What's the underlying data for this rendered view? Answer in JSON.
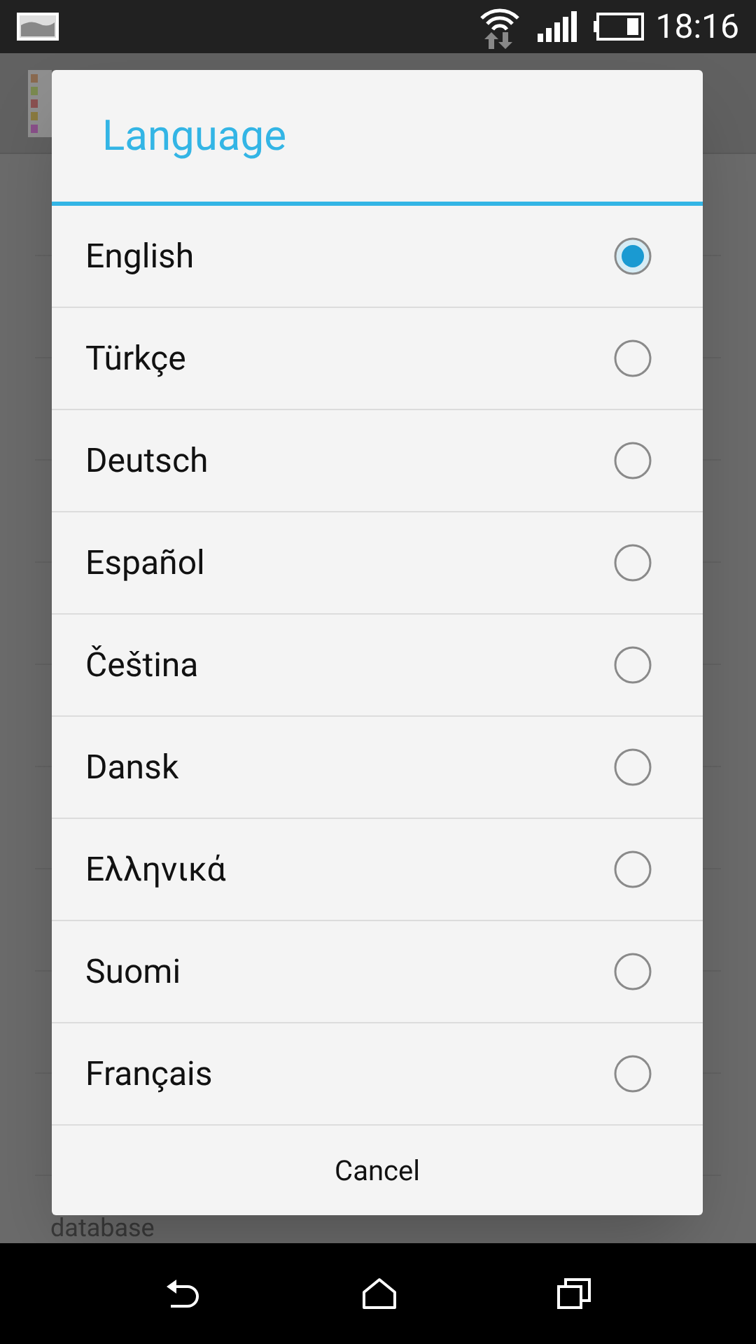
{
  "status_bar": {
    "time": "18:16"
  },
  "background": {
    "text": "database"
  },
  "dialog": {
    "title": "Language",
    "options": [
      {
        "label": "English",
        "selected": true
      },
      {
        "label": "Türkçe",
        "selected": false
      },
      {
        "label": "Deutsch",
        "selected": false
      },
      {
        "label": "Español",
        "selected": false
      },
      {
        "label": "Čeština",
        "selected": false
      },
      {
        "label": "Dansk",
        "selected": false
      },
      {
        "label": "Ελληνικά",
        "selected": false
      },
      {
        "label": "Suomi",
        "selected": false
      },
      {
        "label": "Français",
        "selected": false
      }
    ],
    "cancel": "Cancel"
  }
}
